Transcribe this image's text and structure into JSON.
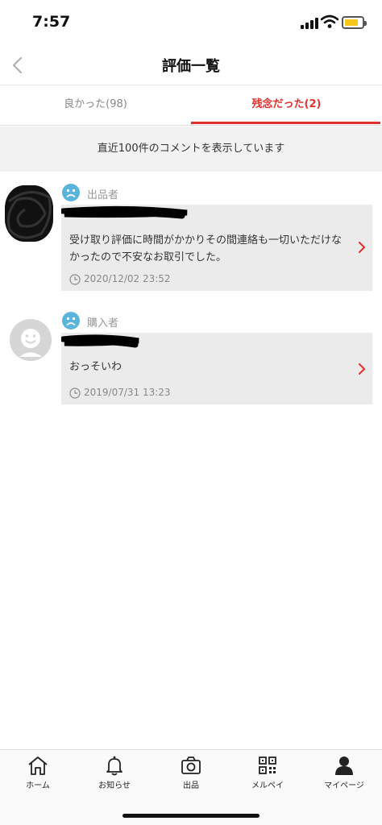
{
  "status_bar": {
    "time": "7:57",
    "battery_color": "#f5c518"
  },
  "header": {
    "title": "評価一覧",
    "back_icon": "chevron-left-icon"
  },
  "tabs": [
    {
      "label": "良かった(98)",
      "active": false
    },
    {
      "label": "残念だった(2)",
      "active": true
    }
  ],
  "notice": "直近100件のコメントを表示しています",
  "reviews": [
    {
      "role": "出品者",
      "rating_icon": "sad-face-icon",
      "comment": "受け取り評価に時間がかかりその間連絡も一切いただけなかったので不安なお取引でした。",
      "date": "2020/12/02 23:52"
    },
    {
      "role": "購入者",
      "rating_icon": "sad-face-icon",
      "comment": "おっそいわ",
      "date": "2019/07/31 13:23"
    }
  ],
  "bottom_nav": [
    {
      "label": "ホーム",
      "icon": "home-icon"
    },
    {
      "label": "お知らせ",
      "icon": "bell-icon"
    },
    {
      "label": "出品",
      "icon": "camera-icon"
    },
    {
      "label": "メルペイ",
      "icon": "qr-code-icon"
    },
    {
      "label": "マイページ",
      "icon": "person-icon"
    }
  ],
  "colors": {
    "accent_red": "#e0302e",
    "sad_face_blue": "#5bb4dc",
    "card_gray": "#ebebeb"
  }
}
